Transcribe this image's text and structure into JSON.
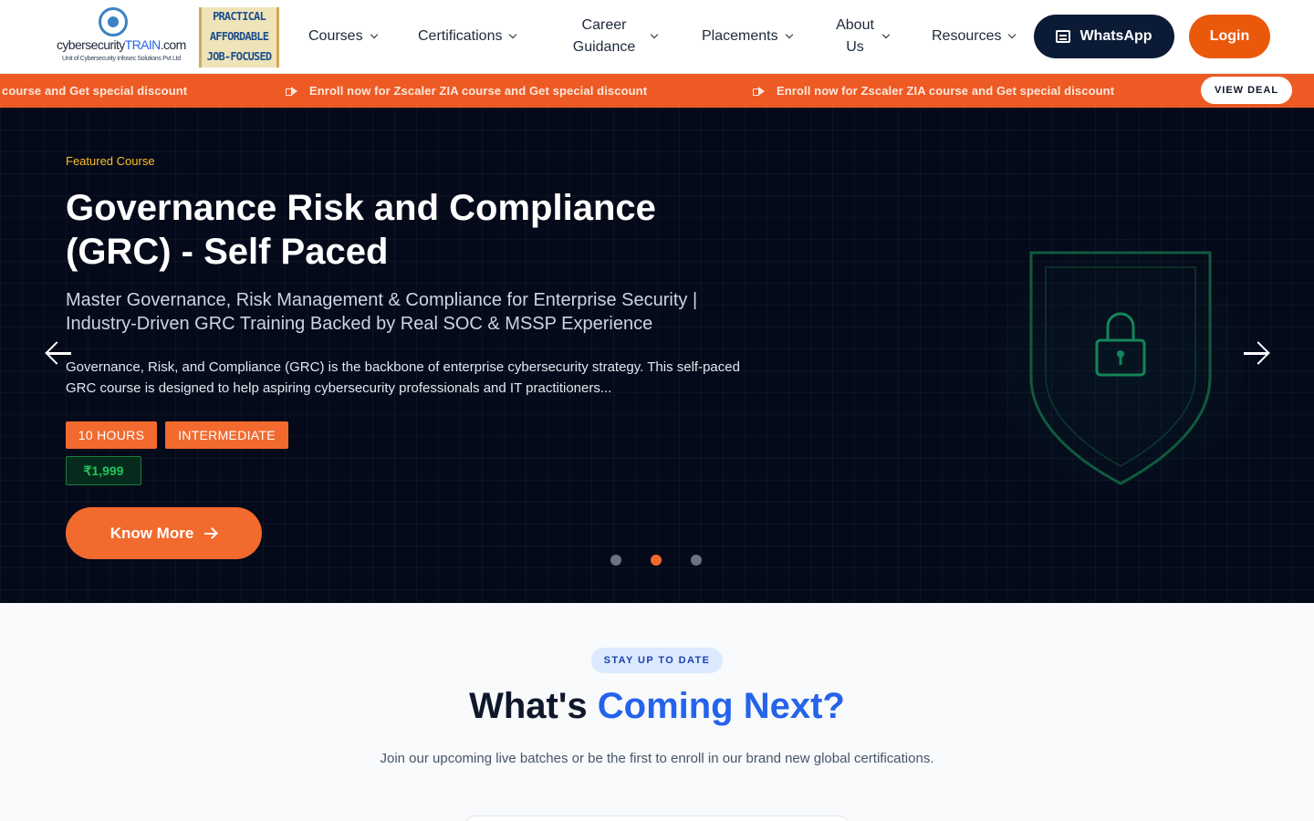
{
  "header": {
    "logo": {
      "text_main": "cybersecurity",
      "text_accent": "TRAIN",
      "text_suffix": ".com",
      "subtitle": "Unit of Cybersecurity Infosec Solutions Pvt Ltd"
    },
    "badge": [
      "PRACTICAL",
      "AFFORDABLE",
      "JOB-FOCUSED"
    ],
    "nav": [
      {
        "label": "Courses"
      },
      {
        "label": "Certifications"
      },
      {
        "label": "Career Guidance"
      },
      {
        "label": "Placements"
      },
      {
        "label": "About Us"
      },
      {
        "label": "Resources"
      }
    ],
    "whatsapp_label": "WhatsApp",
    "login_label": "Login"
  },
  "ticker": {
    "items": [
      "course and Get special discount",
      "Enroll now for Zscaler ZIA course and Get special discount",
      "Enroll now for Zscaler ZIA course and Get special discount"
    ],
    "view_deal_label": "VIEW DEAL"
  },
  "hero": {
    "eyebrow": "Featured Course",
    "title": "Governance Risk and Compliance (GRC) - Self Paced",
    "subtitle": "Master Governance, Risk Management & Compliance for Enterprise Security | Industry-Driven GRC Training Backed by Real SOC & MSSP Experience",
    "description": "Governance, Risk, and Compliance (GRC) is the backbone of enterprise cybersecurity strategy. This self-paced GRC course is designed to help aspiring cybersecurity professionals and IT practitioners...",
    "tags": [
      "10 HOURS",
      "INTERMEDIATE"
    ],
    "price": "₹1,999",
    "cta_label": "Know More",
    "slides_total": 3,
    "active_slide": 2
  },
  "coming_next": {
    "pill": "STAY UP TO DATE",
    "title_plain": "What's",
    "title_accent": "Coming Next?",
    "description": "Join our upcoming live batches or be the first to enroll in our brand new global certifications."
  },
  "colors": {
    "accent": "#ea580c",
    "navy": "#0b1b36",
    "hero_bg": "#050a1a",
    "link_blue": "#2563eb",
    "success": "#22c55e"
  }
}
